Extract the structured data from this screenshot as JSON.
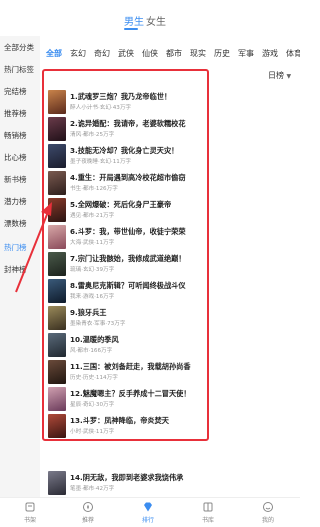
{
  "top_tabs": [
    {
      "label": "男生",
      "active": true
    },
    {
      "label": "女生",
      "active": false
    }
  ],
  "sidebar": {
    "items": [
      {
        "label": "全部分类",
        "active": false
      },
      {
        "label": "热门标签",
        "active": false
      },
      {
        "label": "完结榜",
        "active": false
      },
      {
        "label": "推荐榜",
        "active": false
      },
      {
        "label": "畅销榜",
        "active": false
      },
      {
        "label": "比心榜",
        "active": false
      },
      {
        "label": "新书榜",
        "active": false
      },
      {
        "label": "潜力榜",
        "active": false
      },
      {
        "label": "漂数榜",
        "active": false
      },
      {
        "label": "热门榜",
        "active": true
      },
      {
        "label": "封神榜",
        "active": false
      }
    ]
  },
  "categories": [
    "全部",
    "玄幻",
    "奇幻",
    "武侠",
    "仙侠",
    "都市",
    "现实",
    "历史",
    "军事",
    "游戏",
    "体育"
  ],
  "active_category": "全部",
  "sort": {
    "label": "日榜",
    "icon": "caret-down-icon"
  },
  "books": [
    {
      "title": "1.武魂罗三炮？我乃龙帝临世！",
      "meta": "醉人小计书·玄幻·43万字"
    },
    {
      "title": "2.诡异婚配：我请帝，老婆软糯校花",
      "meta": "清风·都市·25万字"
    },
    {
      "title": "3.技能无冷却？我化身亡灵天灾！",
      "meta": "墨子夜晚睡·玄幻·11万字"
    },
    {
      "title": "4.重生：开局遇到高冷校花超市偷窃",
      "meta": "书生·都市·126万字"
    },
    {
      "title": "5.全网爆破：死后化身尸王豪帝",
      "meta": "遇见·都市·21万字"
    },
    {
      "title": "6.斗罗：我，带世仙帝，收徒宁荣荣",
      "meta": "大海·武侠·11万字"
    },
    {
      "title": "7.宗门让我骸始，我修成武道绝巅！",
      "meta": "琉璃·玄幻·39万字"
    },
    {
      "title": "8.雷奥尼克斯辑？可听闻终极战斗仪",
      "meta": "我来·游戏·16万字"
    },
    {
      "title": "9.狼牙兵王",
      "meta": "墨染青衣·军事·73万字"
    },
    {
      "title": "10.温暖的季风",
      "meta": "风·都市·166万字"
    },
    {
      "title": "11.三国：被刘备赶走，我载胡孙尚香",
      "meta": "历史·历史·114万字"
    },
    {
      "title": "12.魅魔嗯主？反手养成十二冒天使！",
      "meta": "星辰·奇幻·30万字"
    },
    {
      "title": "13.斗罗：凤神降临，帝炎焚天",
      "meta": "小时·武侠·11万字"
    },
    {
      "title": "14.阴无敌，我即到老婆求我饶伟承",
      "meta": "笔墨·都市·42万字"
    }
  ],
  "bottom_nav": [
    {
      "label": "书架",
      "icon": "bookshelf-icon",
      "active": false
    },
    {
      "label": "推荐",
      "icon": "compass-icon",
      "active": false
    },
    {
      "label": "排行",
      "icon": "diamond-icon",
      "active": true
    },
    {
      "label": "书库",
      "icon": "library-icon",
      "active": false
    },
    {
      "label": "我的",
      "icon": "smile-face-icon",
      "active": false
    }
  ],
  "colors": {
    "accent": "#3b8df0",
    "annotation_red": "#e8303a",
    "sidebar_bg": "#f5f5f5"
  }
}
